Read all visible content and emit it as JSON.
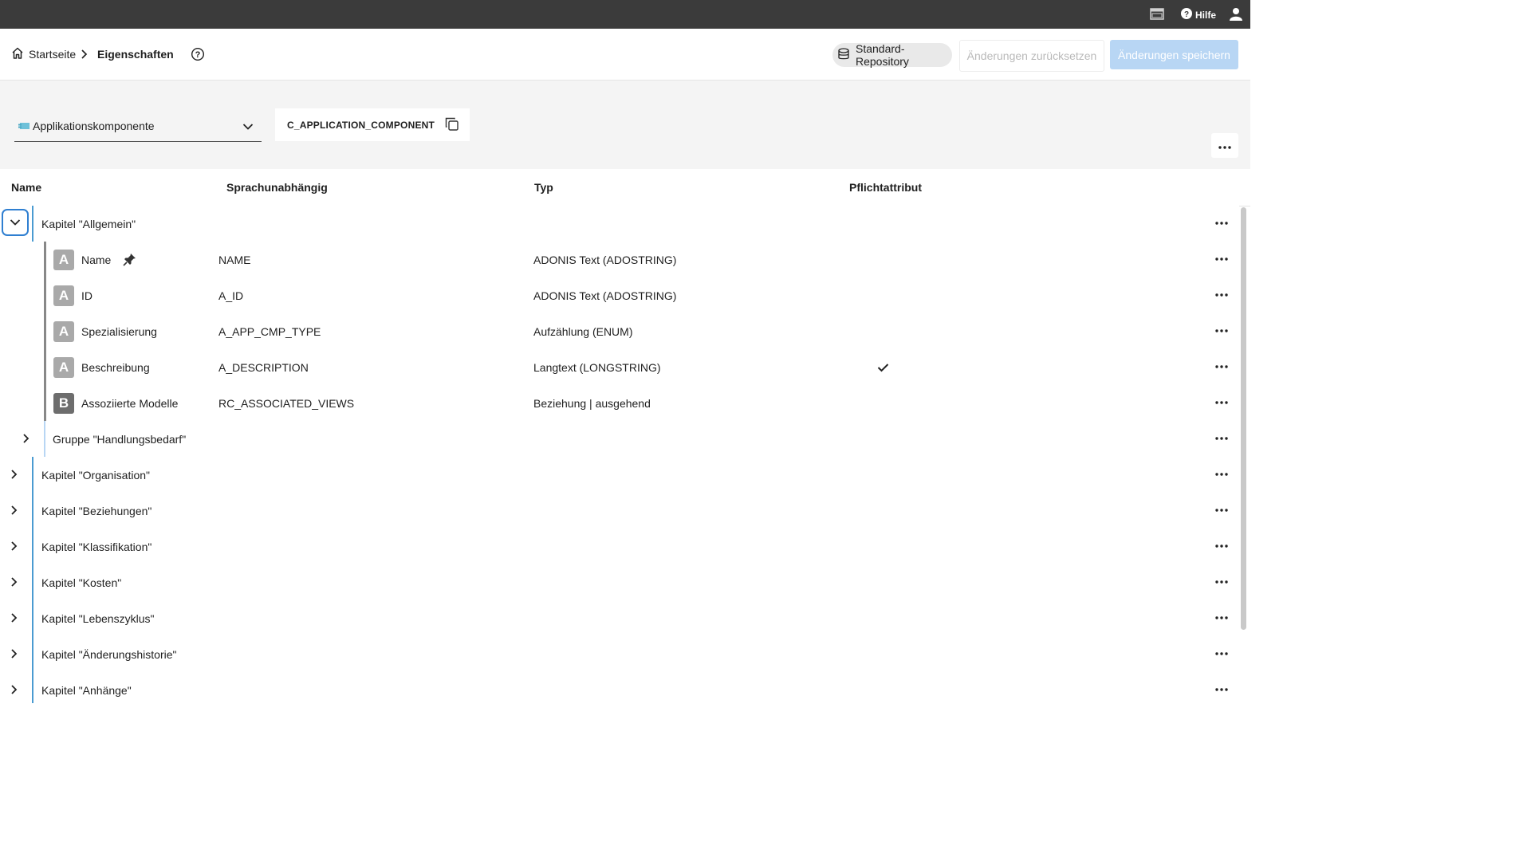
{
  "topbar": {
    "icons": [
      "window-icon",
      "help-icon",
      "user-icon"
    ],
    "help_label": "Hilfe"
  },
  "header": {
    "breadcrumb_home": "Startseite",
    "breadcrumb_current": "Eigenschaften",
    "repository": "Standard-Repository",
    "reset_label": "Änderungen zurücksetzen",
    "save_label": "Änderungen speichern"
  },
  "class_selector": {
    "selected": "Applikationskomponente",
    "class_id": "C_APPLICATION_COMPONENT"
  },
  "table": {
    "columns": [
      "Name",
      "Sprachunabhängig",
      "Typ",
      "Pflichtattribut"
    ],
    "rows": [
      {
        "kind": "chapter",
        "label": "Kapitel \"Allgemein\"",
        "expanded": true
      },
      {
        "kind": "attribute",
        "badge": "A",
        "name": "Name",
        "id": "NAME",
        "type": "ADONIS Text (ADOSTRING)",
        "mandatory": false,
        "pinned": true
      },
      {
        "kind": "attribute",
        "badge": "A",
        "name": "ID",
        "id": "A_ID",
        "type": "ADONIS Text (ADOSTRING)",
        "mandatory": false
      },
      {
        "kind": "attribute",
        "badge": "A",
        "name": "Spezialisierung",
        "id": "A_APP_CMP_TYPE",
        "type": "Aufzählung (ENUM)",
        "mandatory": false
      },
      {
        "kind": "attribute",
        "badge": "A",
        "name": "Beschreibung",
        "id": "A_DESCRIPTION",
        "type": "Langtext (LONGSTRING)",
        "mandatory": true
      },
      {
        "kind": "attribute",
        "badge": "B",
        "name": "Assoziierte Modelle",
        "id": "RC_ASSOCIATED_VIEWS",
        "type": "Beziehung | ausgehend",
        "mandatory": false
      },
      {
        "kind": "group",
        "label": "Gruppe \"Handlungsbedarf\""
      },
      {
        "kind": "chapter",
        "label": "Kapitel \"Organisation\""
      },
      {
        "kind": "chapter",
        "label": "Kapitel \"Beziehungen\""
      },
      {
        "kind": "chapter",
        "label": "Kapitel \"Klassifikation\""
      },
      {
        "kind": "chapter",
        "label": "Kapitel \"Kosten\""
      },
      {
        "kind": "chapter",
        "label": "Kapitel \"Lebenszyklus\""
      },
      {
        "kind": "chapter",
        "label": "Kapitel \"Änderungshistorie\""
      },
      {
        "kind": "chapter",
        "label": "Kapitel \"Anhänge\""
      }
    ]
  },
  "colors": {
    "topbar": "#3b3b3b",
    "accent_chapter": "#4a9bd1",
    "save_button": "#b8d6f4",
    "focus_border": "#2f7fd1"
  }
}
